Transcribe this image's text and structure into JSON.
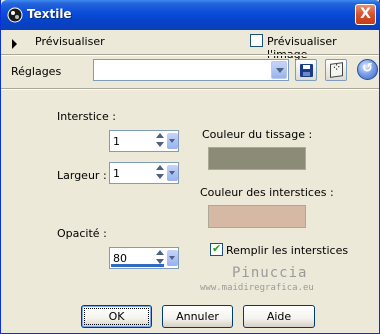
{
  "window": {
    "title": "Textile",
    "close_glyph": "X"
  },
  "preview": {
    "toggle_label": "Prévisualiser",
    "check_label": "Prévisualiser l'image",
    "checked": false
  },
  "presets": {
    "label": "Réglages",
    "value": "",
    "save_icon": "save-icon",
    "random_icon": "dice-icon",
    "reset_icon": "reset-icon"
  },
  "fields": {
    "interstice": {
      "label": "Interstice :",
      "value": "1"
    },
    "largeur": {
      "label": "Largeur :",
      "value": "1"
    },
    "opacite": {
      "label": "Opacité :",
      "value": "80",
      "level": 0.8
    }
  },
  "colors": {
    "weave_label": "Couleur du tissage :",
    "weave_color": "#8c8b78",
    "gap_label": "Couleur des interstices :",
    "gap_color": "#d6b9a5"
  },
  "fill": {
    "label": "Remplir les interstices",
    "checked": true
  },
  "watermark": {
    "line1": "Pinuccia",
    "line2": "www.maidiregrafica.eu"
  },
  "buttons": {
    "ok": "OK",
    "cancel": "Annuler",
    "help": "Aide"
  },
  "theme": {
    "title_bar": "#0a4bd8",
    "face": "#ece9d8",
    "accent": "#316ac5"
  }
}
